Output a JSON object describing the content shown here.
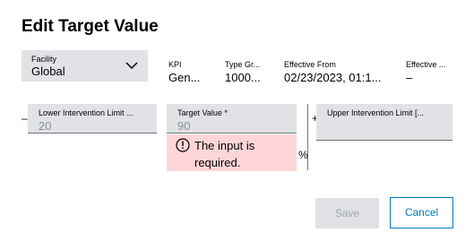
{
  "dialog": {
    "title": "Edit Target Value"
  },
  "facility": {
    "label": "Facility",
    "value": "Global"
  },
  "columns": [
    {
      "label": "KPI",
      "value": "Gen..."
    },
    {
      "label": "Type Gr...",
      "value": "1000..."
    },
    {
      "label": "Effective From",
      "value": "02/23/2023, 01:1..."
    },
    {
      "label": "Effective ...",
      "value": "–"
    }
  ],
  "lower_limit": {
    "sign": "–",
    "label": "Lower Intervention Limit ...",
    "placeholder": "20"
  },
  "target": {
    "label": "Target Value *",
    "placeholder": "90",
    "error": "The input is required.",
    "unit": "%"
  },
  "upper_limit": {
    "sign": "+",
    "label": "Upper Intervention Limit [..."
  },
  "buttons": {
    "save": "Save",
    "cancel": "Cancel"
  },
  "colors": {
    "accent": "#007bc0",
    "error_bg": "#ffd6d8",
    "field_bg": "#e0e2e5"
  }
}
